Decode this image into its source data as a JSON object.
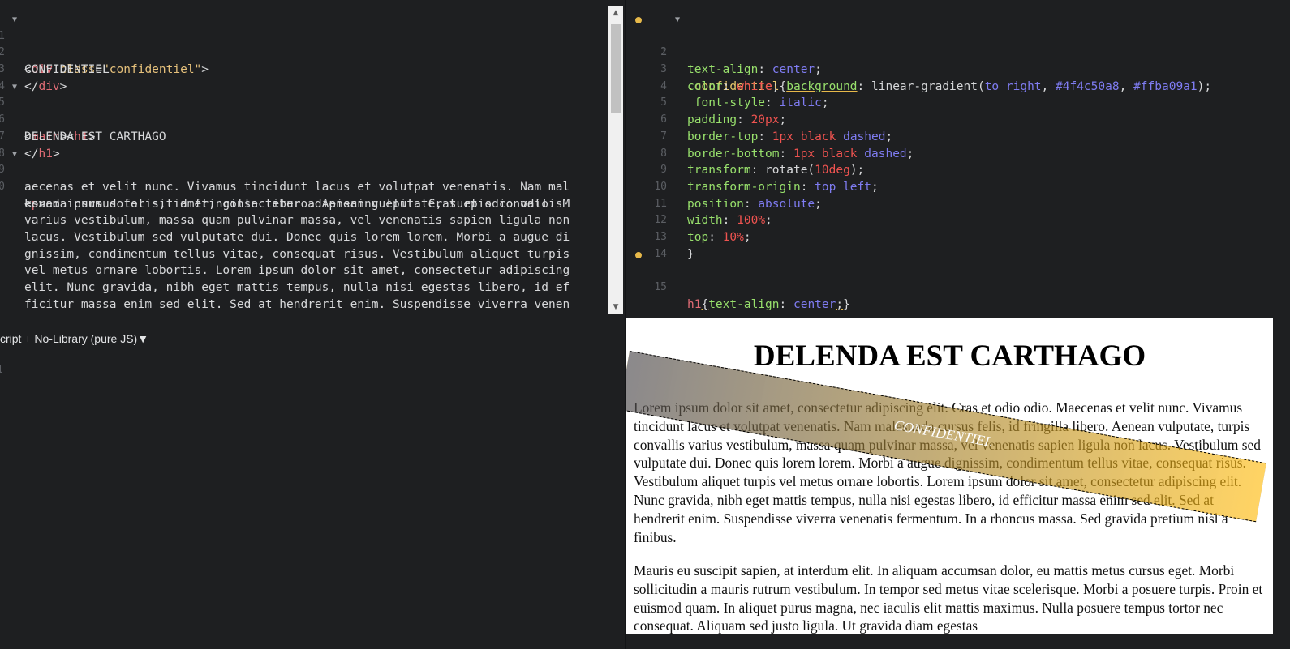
{
  "html_editor": {
    "lines": [
      {
        "n": "1",
        "fold": true
      },
      {
        "n": "2"
      },
      {
        "n": "3"
      },
      {
        "n": "4"
      },
      {
        "n": "5",
        "fold": true
      },
      {
        "n": "6"
      },
      {
        "n": "7"
      },
      {
        "n": "8"
      },
      {
        "n": "9",
        "fold": true
      },
      {
        "n": "0"
      }
    ],
    "div_open_tag": "div",
    "div_attr": "class",
    "div_attr_value": "\"confidentiel\"",
    "div_text": "CONFIDENTIEL",
    "div_close": "</div>",
    "main_tag": "main",
    "h1_tag": "h1",
    "h1_text": "DELENDA EST CARTHAGO",
    "h1_close": "</h1>",
    "p_tag": "p",
    "p_lines": [
      "Lorem ipsum dolor sit amet, consectetur adipiscing elit. Cras et odio odio. M",
      "aecenas et velit nunc. Vivamus tincidunt lacus et volutpat venenatis. Nam mal",
      "esuada cursus felis, id fringilla libero. Aenean vulputate, turpis convallis ",
      "varius vestibulum, massa quam pulvinar massa, vel venenatis sapien ligula non",
      "lacus. Vestibulum sed vulputate dui. Donec quis lorem lorem. Morbi a augue di",
      "gnissim, condimentum tellus vitae, consequat risus. Vestibulum aliquet turpis",
      "vel metus ornare lobortis. Lorem ipsum dolor sit amet, consectetur adipiscing",
      "elit. Nunc gravida, nibh eget mattis tempus, nulla nisi egestas libero, id ef",
      "ficitur massa enim sed elit. Sed at hendrerit enim. Suspendisse viverra venen"
    ],
    "scroll_up": "▲",
    "scroll_down": "▼"
  },
  "css_editor": {
    "line_numbers": [
      "1",
      "2",
      "3",
      "4",
      "5",
      "6",
      "7",
      "8",
      "9",
      "10",
      "11",
      "12",
      "13",
      "14",
      "15"
    ],
    "l1": {
      "selector": ".confidentiel",
      "prop": "background",
      "fn": "linear-gradient(",
      "kw": "to right",
      "c1": "#4f4c50a8",
      "c2": "#ffba09a1",
      "end": ");"
    },
    "l2": {
      "prop": "text-align",
      "val": "center"
    },
    "l3": {
      "prop": "color",
      "val": "white"
    },
    "l4": {
      "prop": "font-style",
      "val": "italic"
    },
    "l5": {
      "prop": "padding",
      "val": "20px"
    },
    "l6": {
      "prop": "border-top",
      "v1": "1px black",
      "v2": "dashed"
    },
    "l7": {
      "prop": "border-bottom",
      "v1": "1px black",
      "v2": "dashed"
    },
    "l8": {
      "prop": "transform",
      "fn": "rotate(",
      "v": "10deg",
      "end": ");"
    },
    "l9": {
      "prop": "transform-origin",
      "val": "top left"
    },
    "l10": {
      "prop": "position",
      "val": "absolute"
    },
    "l11": {
      "prop": "width",
      "val": "100%"
    },
    "l12": {
      "prop": "top",
      "val": "10%"
    },
    "l13": "}",
    "l15": {
      "selector": "h1",
      "prop": "text-align",
      "val": "center"
    }
  },
  "js_editor": {
    "language_label": "cript + No-Library (pure JS)",
    "dropdown_glyph": "▼",
    "line_number": "1"
  },
  "result": {
    "h1": "DELENDA EST CARTHAGO",
    "banner": "CONFIDENTIEL",
    "p1": "Lorem ipsum dolor sit amet, consectetur adipiscing elit. Cras et odio odio. Maecenas et velit nunc. Vivamus tincidunt lacus et volutpat venenatis. Nam malesuada cursus felis, id fringilla libero. Aenean vulputate, turpis convallis varius vestibulum, massa quam pulvinar massa, vel venenatis sapien ligula non lacus. Vestibulum sed vulputate dui. Donec quis lorem lorem. Morbi a augue dignissim, condimentum tellus vitae, consequat risus. Vestibulum aliquet turpis vel metus ornare lobortis. Lorem ipsum dolor sit amet, consectetur adipiscing elit. Nunc gravida, nibh eget mattis tempus, nulla nisi egestas libero, id efficitur massa enim sed elit. Sed at hendrerit enim. Suspendisse viverra venenatis fermentum. In a rhoncus massa. Sed gravida pretium nisl a finibus.",
    "p2": "Mauris eu suscipit sapien, at interdum elit. In aliquam accumsan dolor, eu mattis metus cursus eget. Morbi sollicitudin a mauris rutrum vestibulum. In tempor sed metus vitae scelerisque. Morbi a posuere turpis. Proin et euismod quam. In aliquet purus magna, nec iaculis elit mattis maximus. Nulla posuere tempus tortor nec consequat. Aliquam sed justo ligula. Ut gravida diam egestas"
  }
}
